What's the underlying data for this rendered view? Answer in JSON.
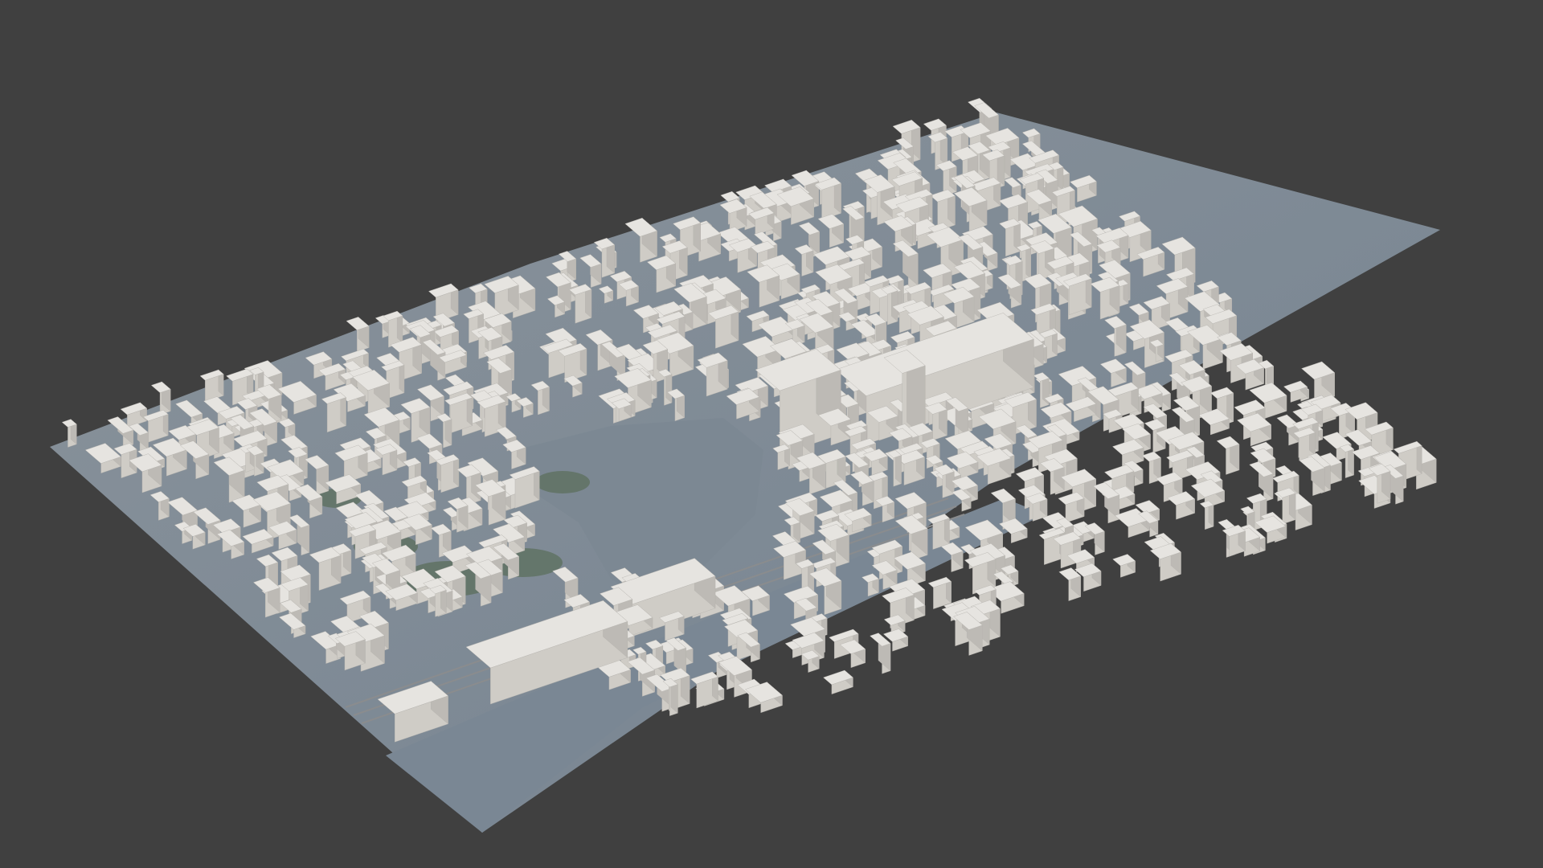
{
  "viewport": {
    "background_color": "#404040",
    "content": "3d-city-model",
    "colors": {
      "ground": "#7f8b96",
      "water": "#7a8794",
      "greenery": "#5e7060",
      "building_roof": "#e6e4e0",
      "building_side": "#cfccc6",
      "building_shadow": "#a9a6a1",
      "rail": "#8a8c8e"
    }
  }
}
